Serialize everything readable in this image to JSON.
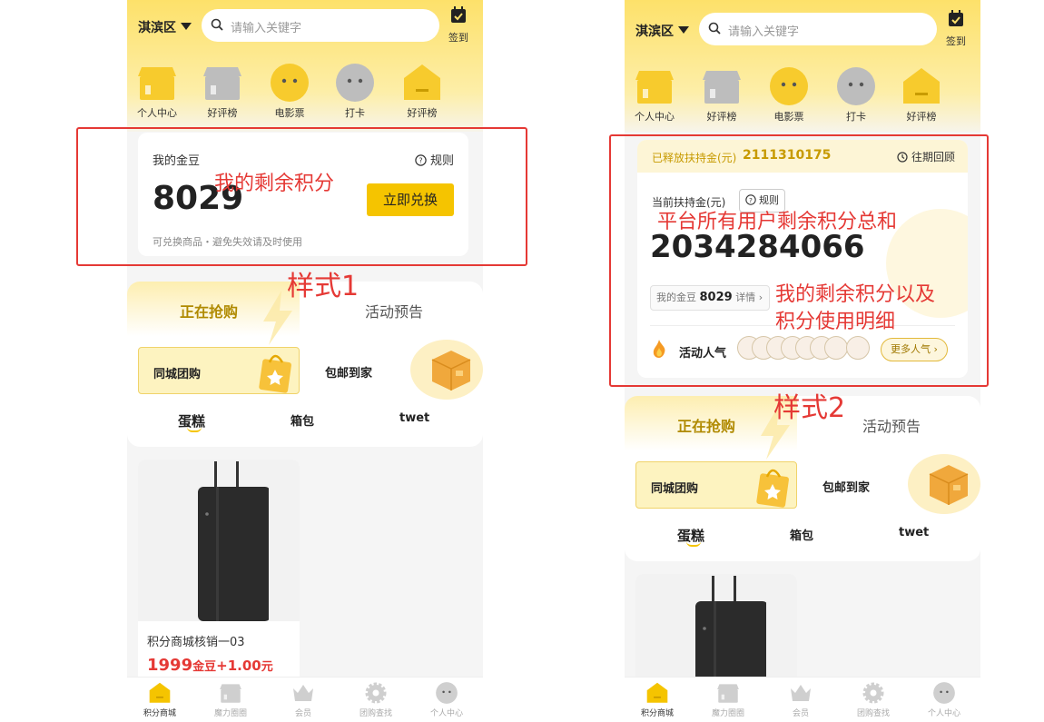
{
  "colors": {
    "accent": "#f5c400",
    "brand_yellow": "#fde16a",
    "annotation_red": "#e53935",
    "price_red": "#e53935"
  },
  "header": {
    "district": "淇滨区",
    "search_placeholder": "请输入关键字",
    "sign_label": "签到"
  },
  "categories": [
    {
      "label": "个人中心",
      "icon": "shop-yellow-icon"
    },
    {
      "label": "好评榜",
      "icon": "shop-gray-icon"
    },
    {
      "label": "电影票",
      "icon": "face-yellow-icon"
    },
    {
      "label": "打卡",
      "icon": "face-gray-icon"
    },
    {
      "label": "好评榜",
      "icon": "house-yellow-icon"
    }
  ],
  "style1": {
    "title": "我的金豆",
    "rules": "规则",
    "points": "8029",
    "button": "立即兑换",
    "note": "可兑换商品・避免失效请及时使用",
    "annotation": "我的剩余积分",
    "caption": "样式1"
  },
  "style2": {
    "released_label": "已释放扶持金(元)",
    "released_value": "2111310175",
    "history": "往期回顾",
    "current_label": "当前扶持金(元)",
    "rules": "规则",
    "total": "2034284066",
    "my_beans_label": "我的金豆",
    "my_beans_value": "8029",
    "detail": "详情",
    "popularity_label": "活动人气",
    "more_button": "更多人气",
    "annotation_total": "平台所有用户剩余积分总和",
    "annotation_mine_1": "我的剩余积分以及",
    "annotation_mine_2": "积分使用明细",
    "caption": "样式2"
  },
  "tabs": {
    "active": "正在抢购",
    "inactive": "活动预告"
  },
  "tiles": {
    "group": "同城团购",
    "shipping": "包邮到家"
  },
  "subcats": [
    "蛋糕",
    "箱包",
    "twet"
  ],
  "product": {
    "name": "积分商城核销一03",
    "price_beans": "1999",
    "beans_unit": "金豆",
    "price_extra": "+1.00",
    "yuan_unit": "元"
  },
  "nav": [
    {
      "label": "积分商城",
      "icon": "shop-active-icon",
      "active": true
    },
    {
      "label": "魔力圈圈",
      "icon": "shop-gray-icon",
      "active": false
    },
    {
      "label": "会员",
      "icon": "crown-icon",
      "active": false
    },
    {
      "label": "团购查找",
      "icon": "gear-icon",
      "active": false
    },
    {
      "label": "个人中心",
      "icon": "face-icon",
      "active": false
    }
  ]
}
